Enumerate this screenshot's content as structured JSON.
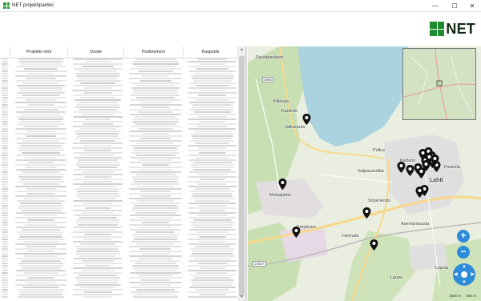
{
  "window": {
    "title": "NET projektipankki",
    "min_glyph": "—",
    "max_glyph": "☐",
    "close_glyph": "✕"
  },
  "header": {
    "logo_text": "NET"
  },
  "table": {
    "columns": [
      "Projektin nimi",
      "Osoite",
      "Postinumero",
      "Kaupunki"
    ],
    "row_count": 100
  },
  "map": {
    "labels": [
      "Rautakankare",
      "2956",
      "Kiikkula",
      "Kankola",
      "Jalkaranta",
      "Pallus",
      "Kartano",
      "Salpausselkä",
      "Paavola",
      "Lahti",
      "Metsäpelto",
      "Sopenkorpi",
      "Kärpänen",
      "Asemantausta",
      "Hennala",
      "14037",
      "Laune",
      "Liipola"
    ],
    "zoom_in": "+",
    "zoom_out": "−",
    "scale_labels": [
      "2500 m",
      "500 m"
    ],
    "pin_count": 20,
    "colors": {
      "water": "#aad3df",
      "forest": "#c8dfb4",
      "residential": "#e0dfdf",
      "road": "#f7d88a",
      "control": "#2d8bd8",
      "brand": "#1f8a2f"
    }
  }
}
